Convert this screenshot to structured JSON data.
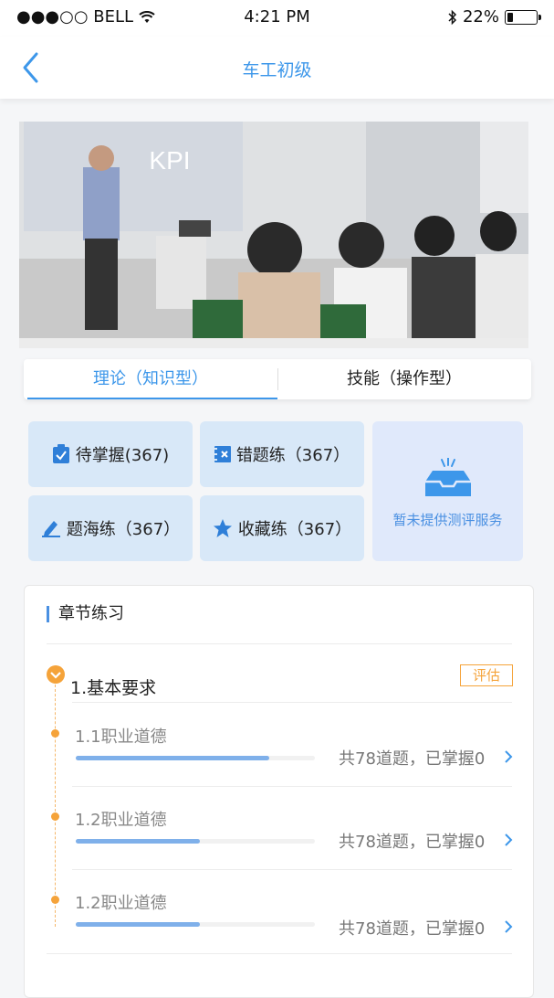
{
  "status_bar": {
    "carrier": "●●●○○ BELL",
    "time": "4:21 PM",
    "battery": "22%",
    "battery_level": 0.22
  },
  "nav": {
    "title": "车工初级",
    "back_icon": "chevron-left-icon"
  },
  "hero": {
    "sign_text": "KPI"
  },
  "tabs": [
    {
      "label": "理论（知识型）",
      "active": true
    },
    {
      "label": "技能（操作型）",
      "active": false
    }
  ],
  "tiles": [
    {
      "label": "待掌握(367)",
      "icon": "clipboard-check-icon"
    },
    {
      "label": "错题练（367）",
      "icon": "notebook-x-icon"
    },
    {
      "label": "题海练（367）",
      "icon": "edit-pen-icon"
    },
    {
      "label": "收藏练（367）",
      "icon": "star-icon"
    }
  ],
  "evaluation_tile": {
    "text": "暂未提供测评服务",
    "icon": "empty-tray-icon"
  },
  "chapter": {
    "heading": "章节练习",
    "section_title": "1.基本要求",
    "badge": "评估",
    "items": [
      {
        "title": "1.1职业道德",
        "count": "共78道题，已掌握0",
        "progress": 0.81
      },
      {
        "title": "1.2职业道德",
        "count": "共78道题，已掌握0",
        "progress": 0.52
      },
      {
        "title": "1.2职业道德",
        "count": "共78道题，已掌握0",
        "progress": 0.52
      }
    ]
  },
  "colors": {
    "accent": "#3d97ea",
    "orange": "#f5a33a",
    "tile_bg": "#d8e8f8",
    "progress": "#7fb0ea"
  }
}
